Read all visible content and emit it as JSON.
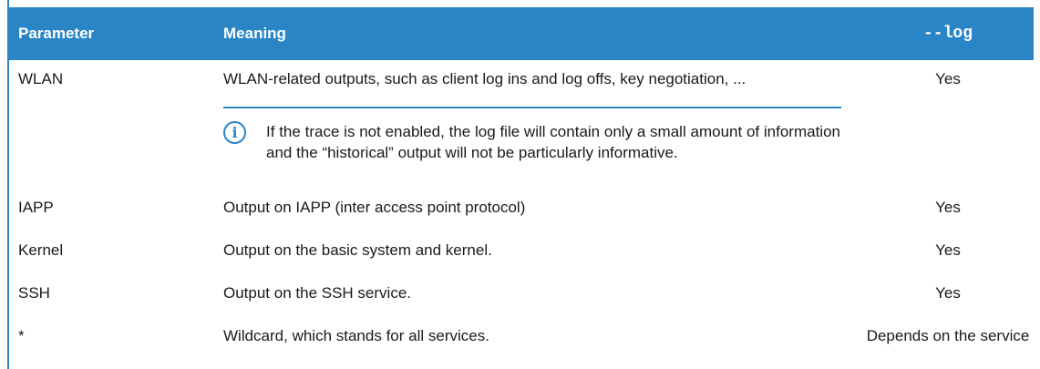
{
  "table": {
    "headers": {
      "parameter": "Parameter",
      "meaning": "Meaning",
      "log": "--log"
    },
    "rows": [
      {
        "parameter": "WLAN",
        "meaning": "WLAN-related outputs, such as client log ins and log offs, key negotiation, ...",
        "log": "Yes"
      },
      {
        "parameter": "IAPP",
        "meaning": "Output on IAPP (inter access point protocol)",
        "log": "Yes"
      },
      {
        "parameter": "Kernel",
        "meaning": "Output on the basic system and kernel.",
        "log": "Yes"
      },
      {
        "parameter": "SSH",
        "meaning": "Output on the SSH service.",
        "log": "Yes"
      },
      {
        "parameter": "*",
        "meaning": "Wildcard, which stands for all services.",
        "log": "Depends on the service"
      }
    ],
    "note": {
      "icon": "info-icon",
      "text": "If the trace is not enabled, the log file will contain only a small amount of information and the “historical” output will not be particularly informative."
    }
  },
  "colors": {
    "header_bg": "#2a85c6",
    "header_text": "#ffffff",
    "accent": "#2a85c6"
  }
}
